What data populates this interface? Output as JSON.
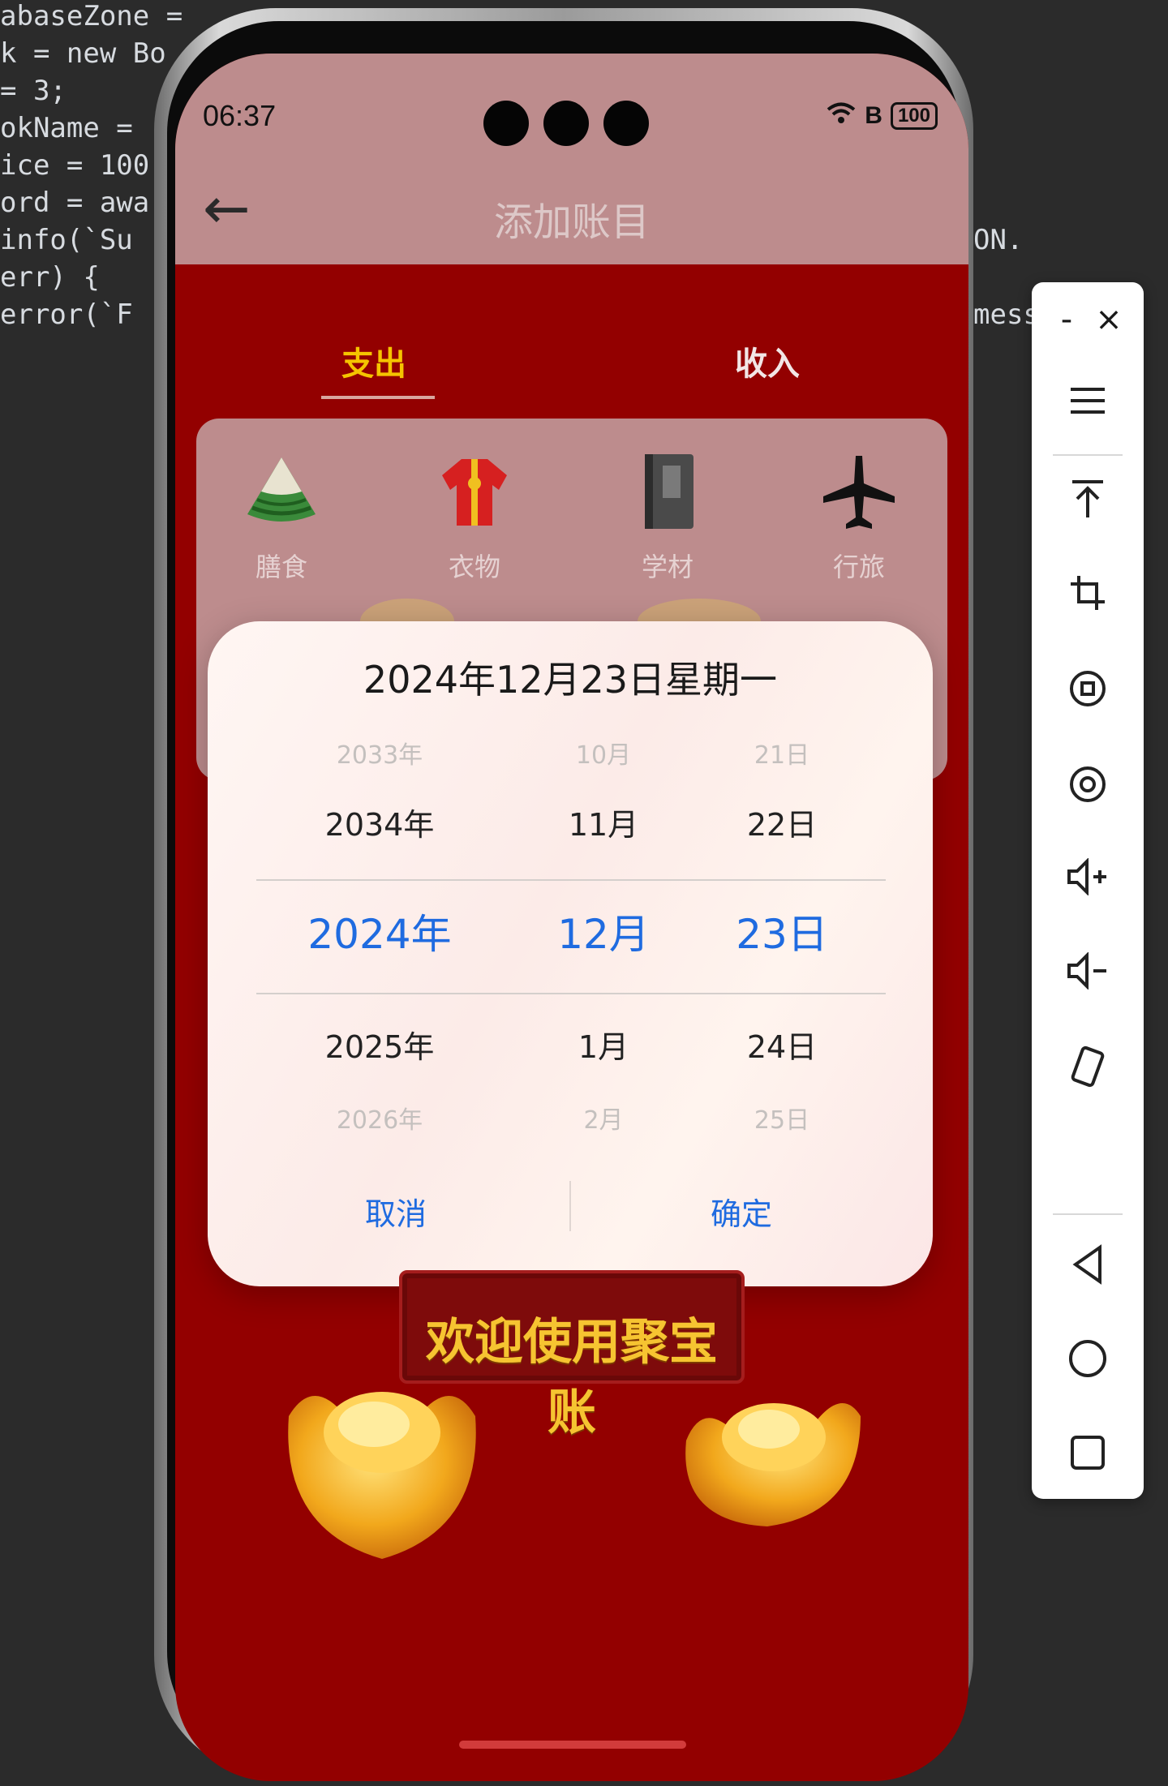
{
  "ide": {
    "lines": [
      "abaseZone =",
      "k = new Bo",
      "= 3;",
      "okName =",
      "ice = 100",
      "ord = awa",
      "info(`Su",
      "err) {",
      "error(`F"
    ],
    "right_fragments": [
      "ON.",
      "mess"
    ]
  },
  "status_bar": {
    "time": "06:37",
    "battery": "100"
  },
  "header": {
    "title": "添加账目",
    "back_label": "←"
  },
  "tabs": [
    {
      "label": "支出",
      "active": true
    },
    {
      "label": "收入",
      "active": false
    }
  ],
  "categories": [
    {
      "label": "膳食",
      "icon": "zongzi-icon"
    },
    {
      "label": "衣物",
      "icon": "clothes-icon"
    },
    {
      "label": "学材",
      "icon": "book-icon"
    },
    {
      "label": "行旅",
      "icon": "airplane-icon"
    }
  ],
  "date_dialog": {
    "title": "2024年12月23日星期一",
    "years": [
      "2033年",
      "2034年",
      "2024年",
      "2025年",
      "2026年"
    ],
    "months": [
      "10月",
      "11月",
      "12月",
      "1月",
      "2月"
    ],
    "days": [
      "21日",
      "22日",
      "23日",
      "24日",
      "25日"
    ],
    "cancel": "取消",
    "confirm": "确定",
    "accent_color": "#1f6be0"
  },
  "welcome_banner": "欢迎使用聚宝账",
  "toolbar": {
    "minimize": "-",
    "close": "×"
  },
  "colors": {
    "app_bg": "#930000",
    "header_overlay": "#bd8c8d",
    "active_tab": "#f5c400"
  }
}
